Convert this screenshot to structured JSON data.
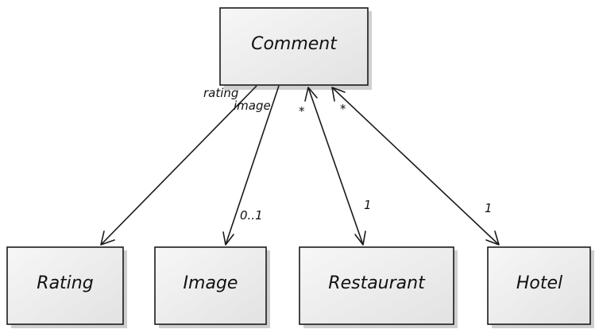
{
  "diagram": {
    "classes": {
      "comment": "Comment",
      "rating": "Rating",
      "image": "Image",
      "restaurant": "Restaurant",
      "hotel": "Hotel"
    },
    "edges": {
      "rating": {
        "role": "rating"
      },
      "image": {
        "role": "image",
        "multiplicity": "0..1"
      },
      "restaurant": {
        "source_multiplicity": "*",
        "target_multiplicity": "1"
      },
      "hotel": {
        "source_multiplicity": "*",
        "target_multiplicity": "1"
      }
    }
  }
}
